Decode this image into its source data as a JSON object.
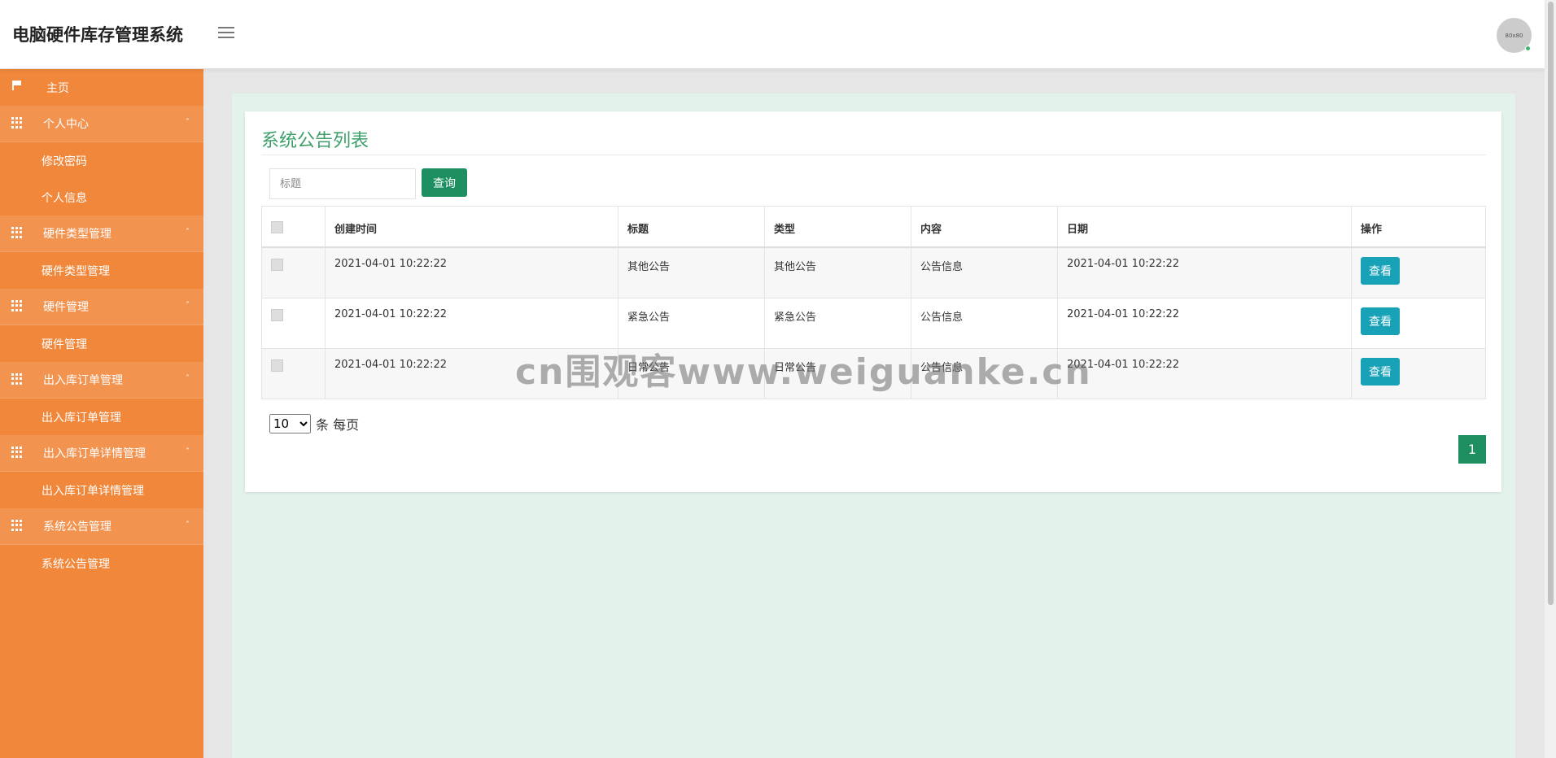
{
  "header": {
    "title": "电脑硬件库存管理系统",
    "avatar_text": "80x80"
  },
  "sidebar": {
    "items": [
      {
        "label": "主页",
        "type": "top",
        "icon": "flag-icon"
      },
      {
        "label": "个人中心",
        "type": "group",
        "icon": "grid-icon"
      },
      {
        "label": "修改密码",
        "type": "sub"
      },
      {
        "label": "个人信息",
        "type": "sub"
      },
      {
        "label": "硬件类型管理",
        "type": "group",
        "icon": "grid-icon"
      },
      {
        "label": "硬件类型管理",
        "type": "sub"
      },
      {
        "label": "硬件管理",
        "type": "group",
        "icon": "grid-icon"
      },
      {
        "label": "硬件管理",
        "type": "sub"
      },
      {
        "label": "出入库订单管理",
        "type": "group",
        "icon": "grid-icon"
      },
      {
        "label": "出入库订单管理",
        "type": "sub"
      },
      {
        "label": "出入库订单详情管理",
        "type": "group",
        "icon": "grid-icon"
      },
      {
        "label": "出入库订单详情管理",
        "type": "sub"
      },
      {
        "label": "系统公告管理",
        "type": "group",
        "icon": "grid-icon"
      },
      {
        "label": "系统公告管理",
        "type": "sub"
      }
    ],
    "caret": "˄"
  },
  "main": {
    "title": "系统公告列表",
    "search": {
      "placeholder": "标题",
      "button": "查询"
    },
    "table": {
      "headers": [
        "创建时间",
        "标题",
        "类型",
        "内容",
        "日期",
        "操作"
      ],
      "rows": [
        {
          "created": "2021-04-01 10:22:22",
          "title": "其他公告",
          "type": "其他公告",
          "content": "公告信息",
          "date": "2021-04-01 10:22:22",
          "action": "查看"
        },
        {
          "created": "2021-04-01 10:22:22",
          "title": "紧急公告",
          "type": "紧急公告",
          "content": "公告信息",
          "date": "2021-04-01 10:22:22",
          "action": "查看"
        },
        {
          "created": "2021-04-01 10:22:22",
          "title": "日常公告",
          "type": "日常公告",
          "content": "公告信息",
          "date": "2021-04-01 10:22:22",
          "action": "查看"
        }
      ]
    },
    "pagination": {
      "page_size": "10",
      "page_size_suffix": "条 每页",
      "current_page": "1"
    }
  },
  "watermark": "cn围观客www.weiguanke.cn",
  "colors": {
    "sidebar": "#f0873a",
    "accent": "#1d8f60",
    "view_button": "#17a2b8",
    "title": "#3c9f6a"
  }
}
